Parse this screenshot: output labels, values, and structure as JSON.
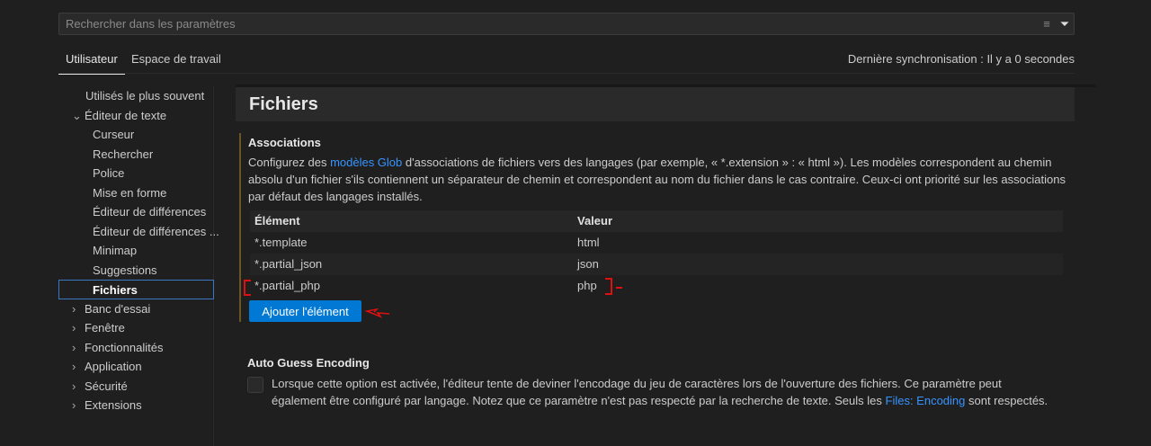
{
  "search": {
    "placeholder": "Rechercher dans les paramètres",
    "clear_icon": "clear-filter-icon",
    "filter_icon": "filter-icon"
  },
  "tabs": [
    {
      "label": "Utilisateur"
    },
    {
      "label": "Espace de travail"
    }
  ],
  "sync_status": "Dernière synchronisation : Il y a 0 secondes",
  "sidebar": {
    "items": [
      {
        "label": "Utilisés le plus souvent"
      },
      {
        "label": "Éditeur de texte"
      },
      {
        "label": "Curseur"
      },
      {
        "label": "Rechercher"
      },
      {
        "label": "Police"
      },
      {
        "label": "Mise en forme"
      },
      {
        "label": "Éditeur de différences"
      },
      {
        "label": "Éditeur de différences ..."
      },
      {
        "label": "Minimap"
      },
      {
        "label": "Suggestions"
      },
      {
        "label": "Fichiers"
      },
      {
        "label": "Banc d'essai"
      },
      {
        "label": "Fenêtre"
      },
      {
        "label": "Fonctionnalités"
      },
      {
        "label": "Application"
      },
      {
        "label": "Sécurité"
      },
      {
        "label": "Extensions"
      }
    ]
  },
  "section_title": "Fichiers",
  "associations": {
    "title": "Associations",
    "desc_pre": "Configurez des ",
    "desc_link": "modèles Glob",
    "desc_post": " d'associations de fichiers vers des langages (par exemple, « *.extension » : « html »). Les modèles correspondent au chemin absolu d'un fichier s'ils contiennent un séparateur de chemin et correspondent au nom du fichier dans le cas contraire. Ceux-ci ont priorité sur les associations par défaut des langages installés.",
    "columns": [
      "Élément",
      "Valeur"
    ],
    "rows": [
      [
        "*.template",
        "html"
      ],
      [
        "*.partial_json",
        "json"
      ],
      [
        "*.partial_php",
        "php"
      ]
    ],
    "add_button": "Ajouter l'élément"
  },
  "auto_guess": {
    "title": "Auto Guess Encoding",
    "desc_pre": "Lorsque cette option est activée, l'éditeur tente de deviner l'encodage du jeu de caractères lors de l'ouverture des fichiers. Ce paramètre peut également être configuré par langage. Notez que ce paramètre n'est pas respecté par la recherche de texte. Seuls les ",
    "desc_link": "Files: Encoding",
    "desc_post": " sont respectés.",
    "checked": false
  }
}
